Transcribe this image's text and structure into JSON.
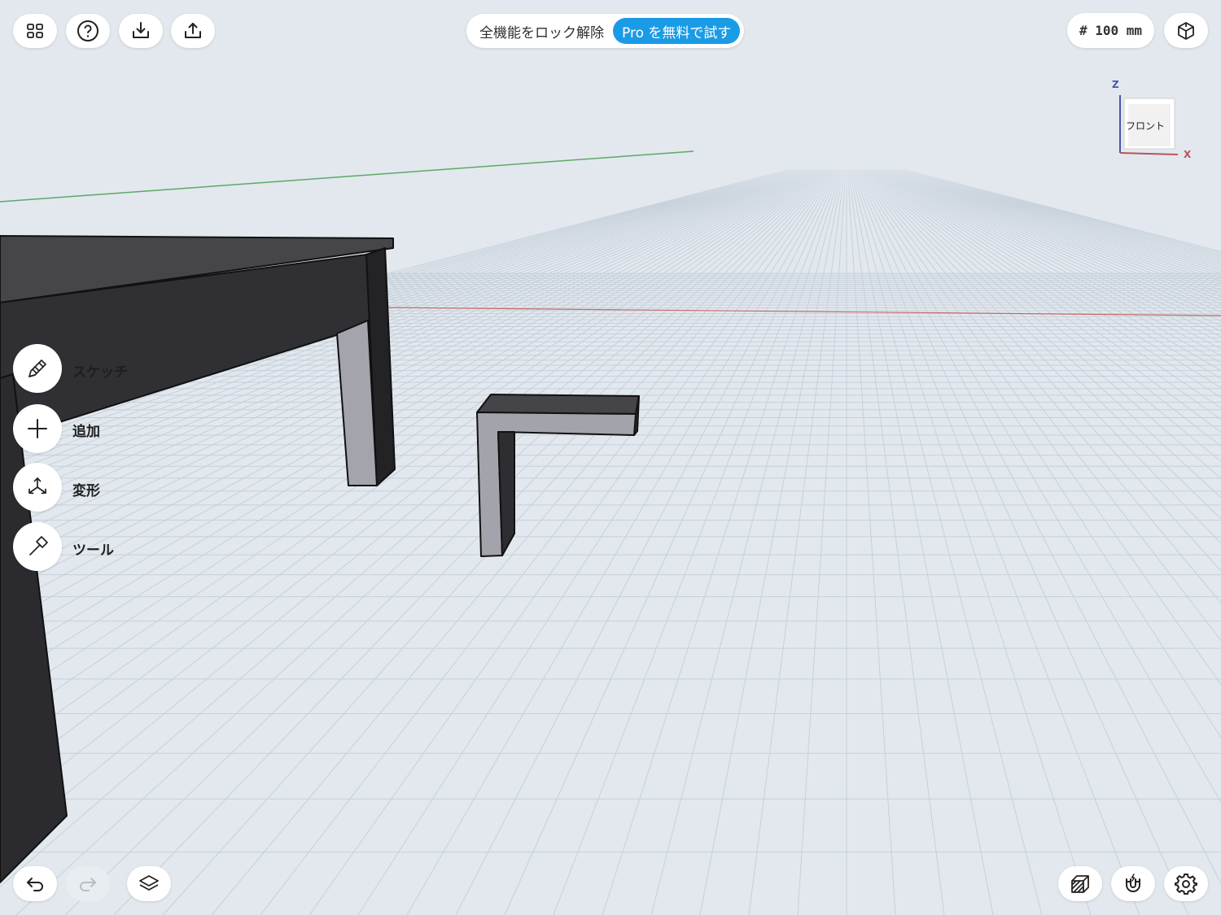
{
  "toolbar": {
    "left_buttons": [
      {
        "icon": "grid-icon"
      },
      {
        "icon": "help-icon"
      },
      {
        "icon": "import-icon"
      },
      {
        "icon": "export-icon"
      }
    ],
    "unit_label": "# 100 mm",
    "view_mode_icon": "isometric-cube-icon"
  },
  "promo": {
    "text": "全機能をロック解除",
    "cta": "Pro を無料で試す",
    "cta_color": "#1a9be6"
  },
  "view_cube": {
    "face_label": "フロント",
    "axis_z": "Z",
    "axis_x": "X"
  },
  "side_tools": [
    {
      "label": "スケッチ",
      "icon": "pencil-icon"
    },
    {
      "label": "追加",
      "icon": "plus-icon"
    },
    {
      "label": "変形",
      "icon": "transform-arrows-icon"
    },
    {
      "label": "ツール",
      "icon": "hammer-icon"
    }
  ],
  "bottom_left": [
    {
      "icon": "undo-icon"
    },
    {
      "icon": "redo-icon",
      "disabled": true
    },
    {
      "icon": "layers-icon"
    }
  ],
  "bottom_right": [
    {
      "icon": "material-hatch-icon"
    },
    {
      "icon": "magnet-snap-icon"
    },
    {
      "icon": "settings-gear-icon"
    }
  ],
  "colors": {
    "background": "#e2e8ee",
    "grid": "#c6d0da",
    "x_axis": "#c0504d",
    "y_axis": "#4caf50",
    "model_dark": "#2f2f33",
    "model_light": "#a3a3ab"
  }
}
